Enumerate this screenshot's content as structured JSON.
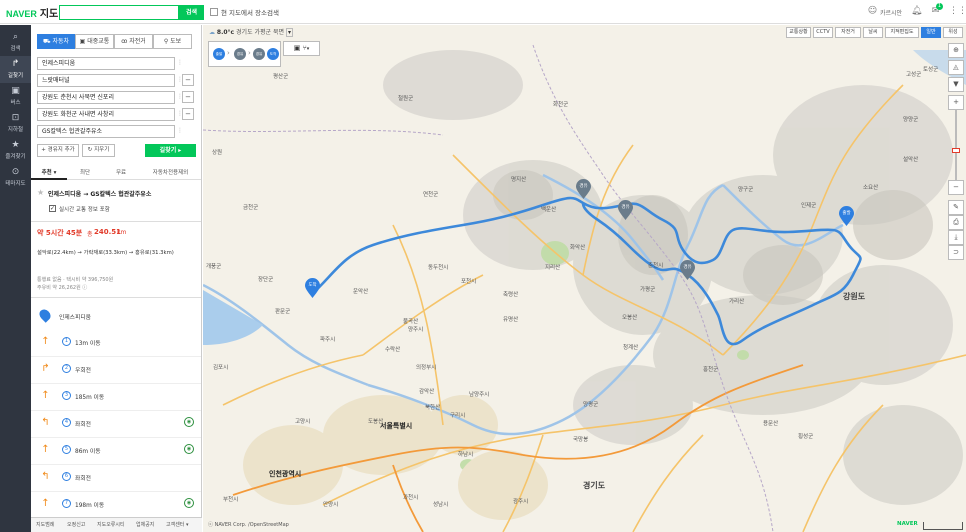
{
  "header": {
    "logo": "NAVER",
    "logo_sub": "지도",
    "search_placeholder": "",
    "search_button": "검색",
    "map_search_check": "현 지도에서 장소검색",
    "user": "카르시안",
    "badge": "1"
  },
  "nav": [
    {
      "icon": "search-icon",
      "label": "검색"
    },
    {
      "icon": "directions-icon",
      "label": "길찾기"
    },
    {
      "icon": "bus-icon",
      "label": "버스"
    },
    {
      "icon": "subway-icon",
      "label": "지하철"
    },
    {
      "icon": "star-icon",
      "label": "즐겨찾기"
    },
    {
      "icon": "pin-icon",
      "label": "테마지도"
    }
  ],
  "tabs": [
    "자동차",
    "대중교통",
    "자전거",
    "도보"
  ],
  "waypoints": [
    "인제스피디움",
    "느랏매터널",
    "강원도 춘천시 사북면 신포리",
    "강원도 화천군 사내면 사창리",
    "GS칼텍스 헙관갈주유소"
  ],
  "buttons": {
    "add_waypoint": "경유지 추가",
    "clear": "지우기",
    "find_route": "길찾기 ▸"
  },
  "options": [
    "추천 ▾",
    "최단",
    "무료",
    "자동차전용제외"
  ],
  "route": {
    "title": "인제스피디움 → GS칼텍스 헙관갈주유소",
    "realtime": "실시간 교통 정보 포함",
    "time": "약 5시간 45분",
    "distance_label": "총",
    "distance": "240.51",
    "distance_unit": "km",
    "legs": "설악로(22.4km) → 가락재로(33.3km) → 홍유로(31.3km)",
    "toll": "통행료 없음 · 택시비 약 396,750원",
    "fuel": "주유비 약 26,262원 ⓘ"
  },
  "start_label": "인제스피디움",
  "steps": [
    {
      "n": "1",
      "text": "13m 이동",
      "arrow": "↑",
      "cam": false
    },
    {
      "n": "2",
      "text": "우회전",
      "arrow": "↱",
      "cam": false
    },
    {
      "n": "3",
      "text": "185m 이동",
      "arrow": "↑",
      "cam": false
    },
    {
      "n": "4",
      "text": "좌회전",
      "arrow": "↰",
      "cam": true
    },
    {
      "n": "5",
      "text": "86m 이동",
      "arrow": "↑",
      "cam": true
    },
    {
      "n": "6",
      "text": "좌회전",
      "arrow": "↰",
      "cam": false
    },
    {
      "n": "7",
      "text": "198m 이동",
      "arrow": "↑",
      "cam": true
    }
  ],
  "bottom": [
    "지도범례",
    "오정신고",
    "지도오류시티",
    "업체공지",
    "고객센터 ▾"
  ],
  "map": {
    "weather": "8.0°c",
    "location": "경기도 가평군 북면",
    "map_types": [
      "교통상황",
      "CCTV",
      "자전거",
      "날씨",
      "지적편집도",
      "일반",
      "위성"
    ],
    "route_chips": [
      "출발",
      "경유",
      "경유",
      "도착"
    ],
    "pins": {
      "start": "출발",
      "end": "도착",
      "w1": "경유",
      "w2": "경유",
      "w3": "경유"
    },
    "region_labels": [
      "강원도",
      "경기도"
    ],
    "city_labels": [
      "서울특별시",
      "인천광역시"
    ],
    "labels": [
      "토성군",
      "철원군",
      "화천군",
      "연천군",
      "양구군",
      "고성군",
      "인제군",
      "양양군",
      "포천시",
      "가평군",
      "홍천군",
      "춘천시",
      "양주시",
      "파주시",
      "동두천시",
      "의정부시",
      "남양주시",
      "구리시",
      "하남시",
      "광주시",
      "양평군",
      "횡성군",
      "성남시",
      "안양시",
      "과천시",
      "부천시",
      "고양시",
      "김포시",
      "개풍군",
      "장단군",
      "판문군",
      "금천군",
      "평산군",
      "상원",
      "백운산",
      "명지산",
      "용문산",
      "화악산",
      "지리산",
      "가리산",
      "오봉산",
      "국망봉",
      "청계산",
      "유명산",
      "축령산",
      "운악산",
      "감악산",
      "도봉산",
      "북한산",
      "수락산",
      "불곡산",
      "소요산",
      "설악산",
      "점봉산"
    ],
    "credit": "ⓒ NAVER Corp. /OpenStreetMap",
    "mark": "NAVER"
  }
}
